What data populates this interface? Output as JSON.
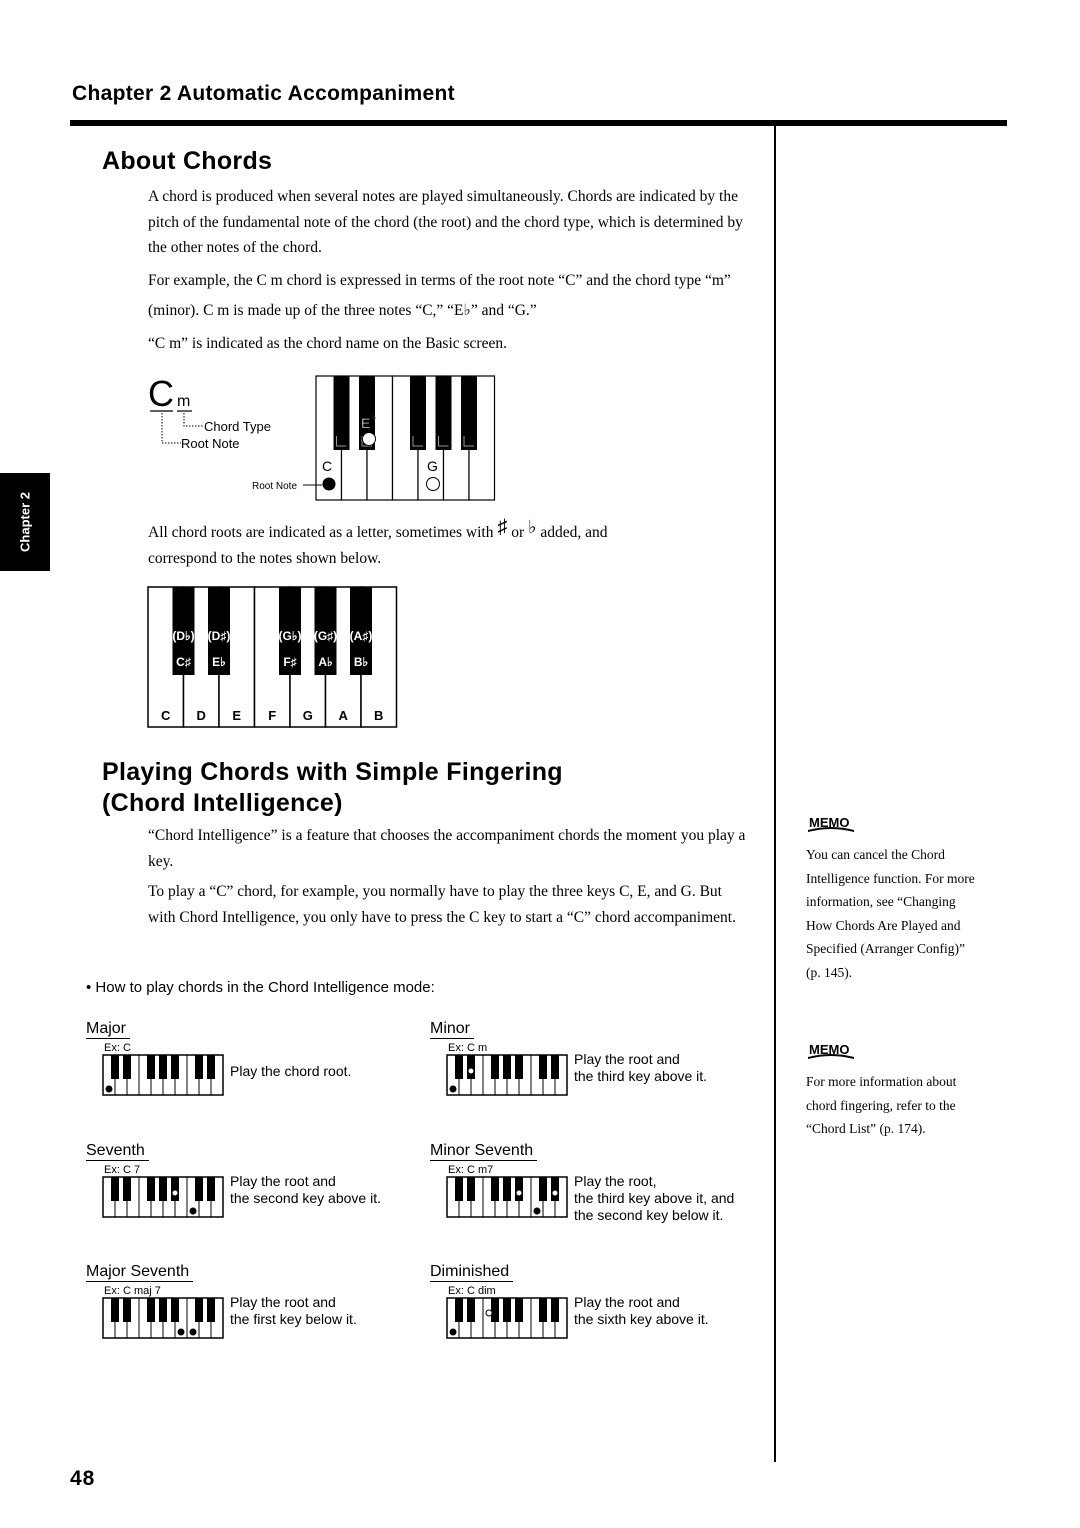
{
  "header": {
    "chapter_title": "Chapter 2  Automatic Accompaniment"
  },
  "side_tab": {
    "label": "Chapter 2"
  },
  "section_about": {
    "heading": "About Chords",
    "paragraphs": [
      "A chord is produced when several notes are played simultaneously. Chords are indicated by the pitch of the fundamental note of the chord (the root) and the chord type, which is determined by the other notes of the chord.",
      "For example, the C m chord is expressed in terms of the root note “C” and the chord type “m” (minor). C m is made up of the three notes “C,” “E♭” and “G.”",
      "“C m” is indicated as the chord name on the Basic screen."
    ],
    "cm_diagram": {
      "root_letter": "C",
      "type_letter": "m",
      "chord_type_label": "Chord Type",
      "root_note_label": "Root Note",
      "key_root_label": "Root Note",
      "note_c": "C",
      "note_eb": "E",
      "flat_sign": "♭",
      "note_g": "G"
    },
    "roots_text_a": "All chord roots are indicated as a letter, sometimes with",
    "sharp_sign": "♯",
    "roots_text_or": "or",
    "flat_sign": "♭",
    "roots_text_b": "added, and",
    "roots_text_c": "correspond to the notes shown below.",
    "keyboard": {
      "white_keys": [
        "C",
        "D",
        "E",
        "F",
        "G",
        "A",
        "B"
      ],
      "black_keys": [
        {
          "alt": "(D♭)",
          "name": "C♯"
        },
        {
          "alt": "(D♯)",
          "name": "E♭"
        },
        {
          "alt": "(G♭)",
          "name": "F♯"
        },
        {
          "alt": "(G♯)",
          "name": "A♭"
        },
        {
          "alt": "(A♯)",
          "name": "B♭"
        }
      ]
    }
  },
  "section_intelligence": {
    "heading_line1": "Playing Chords with Simple Fingering",
    "heading_line2": "(Chord Intelligence)",
    "paragraphs": [
      "“Chord Intelligence” is a feature that chooses the accompaniment chords the moment you play a key.",
      "To play a “C” chord, for example, you normally have to play the three keys C, E, and G. But with Chord Intelligence, you only have to press the C key to start a “C” chord accompaniment."
    ],
    "bullet": "• How to play chords in the Chord Intelligence mode:",
    "chords": [
      {
        "title": "Major",
        "example": "Ex:  C",
        "desc": [
          "Play the chord root."
        ],
        "marks": [
          {
            "key": "w0",
            "fill": "black"
          }
        ]
      },
      {
        "title": "Minor",
        "example": "Ex:  C m",
        "desc": [
          "Play the root and",
          "the third key above it."
        ],
        "marks": [
          {
            "key": "w0",
            "fill": "black"
          },
          {
            "key": "b1",
            "fill": "white"
          }
        ]
      },
      {
        "title": "Seventh",
        "example": "Ex:  C 7",
        "desc": [
          "Play the root and",
          "the second key above it."
        ],
        "marks": [
          {
            "key": "w7",
            "fill": "black"
          },
          {
            "key": "b4",
            "fill": "white"
          }
        ]
      },
      {
        "title": "Minor Seventh",
        "example": "Ex:  C m7",
        "desc": [
          "Play the root,",
          "the third key above it, and",
          "the second key below it."
        ],
        "marks": [
          {
            "key": "w7",
            "fill": "black"
          },
          {
            "key": "b4",
            "fill": "white"
          },
          {
            "key": "b6",
            "fill": "white"
          }
        ]
      },
      {
        "title": "Major Seventh",
        "example": "Ex:  C maj 7",
        "desc": [
          "Play the root and",
          "the first key below it."
        ],
        "marks": [
          {
            "key": "w6",
            "fill": "black"
          },
          {
            "key": "w7",
            "fill": "black"
          }
        ]
      },
      {
        "title": "Diminished",
        "example": "Ex: C dim",
        "desc": [
          "Play the root and",
          "the sixth key above it."
        ],
        "marks": [
          {
            "key": "w0",
            "fill": "black"
          },
          {
            "key": "w3",
            "fill": "white"
          }
        ]
      }
    ]
  },
  "memos": [
    {
      "icon": "memo-icon",
      "icon_text": "MEMO",
      "text": [
        "You can cancel the Chord",
        "Intelligence function. For more",
        "information, see “Changing",
        "How Chords Are Played and",
        "Specified (Arranger Config)”",
        "(p. 145)."
      ]
    },
    {
      "icon": "memo-icon",
      "icon_text": "MEMO",
      "text": [
        "For more information about",
        "chord fingering, refer to the",
        "“Chord List” (p. 174)."
      ]
    }
  ],
  "footer": {
    "page_number": "48"
  }
}
